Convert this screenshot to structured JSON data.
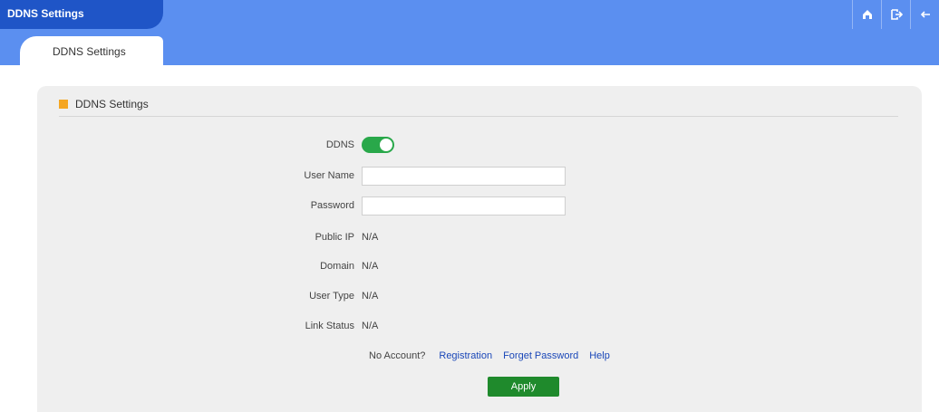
{
  "window": {
    "title": "DDNS Settings"
  },
  "header_icons": [
    {
      "name": "home-icon"
    },
    {
      "name": "logout-icon"
    },
    {
      "name": "back-icon"
    }
  ],
  "tab": {
    "label": "DDNS Settings"
  },
  "section": {
    "title": "DDNS Settings"
  },
  "form": {
    "ddns_label": "DDNS",
    "ddns_enabled": true,
    "username_label": "User Name",
    "username_value": "",
    "password_label": "Password",
    "password_value": "",
    "public_ip_label": "Public IP",
    "public_ip_value": "N/A",
    "domain_label": "Domain",
    "domain_value": "N/A",
    "user_type_label": "User Type",
    "user_type_value": "N/A",
    "link_status_label": "Link Status",
    "link_status_value": "N/A"
  },
  "links": {
    "no_account": "No Account?",
    "registration": "Registration",
    "forget_password": "Forget Password",
    "help": "Help"
  },
  "apply_label": "Apply",
  "colors": {
    "header_blue": "#5b8ff0",
    "title_blue": "#1f55c7",
    "toggle_green": "#29a84a",
    "apply_green": "#1f8a2c",
    "accent_orange": "#f5a623",
    "link_blue": "#1a47b8"
  }
}
